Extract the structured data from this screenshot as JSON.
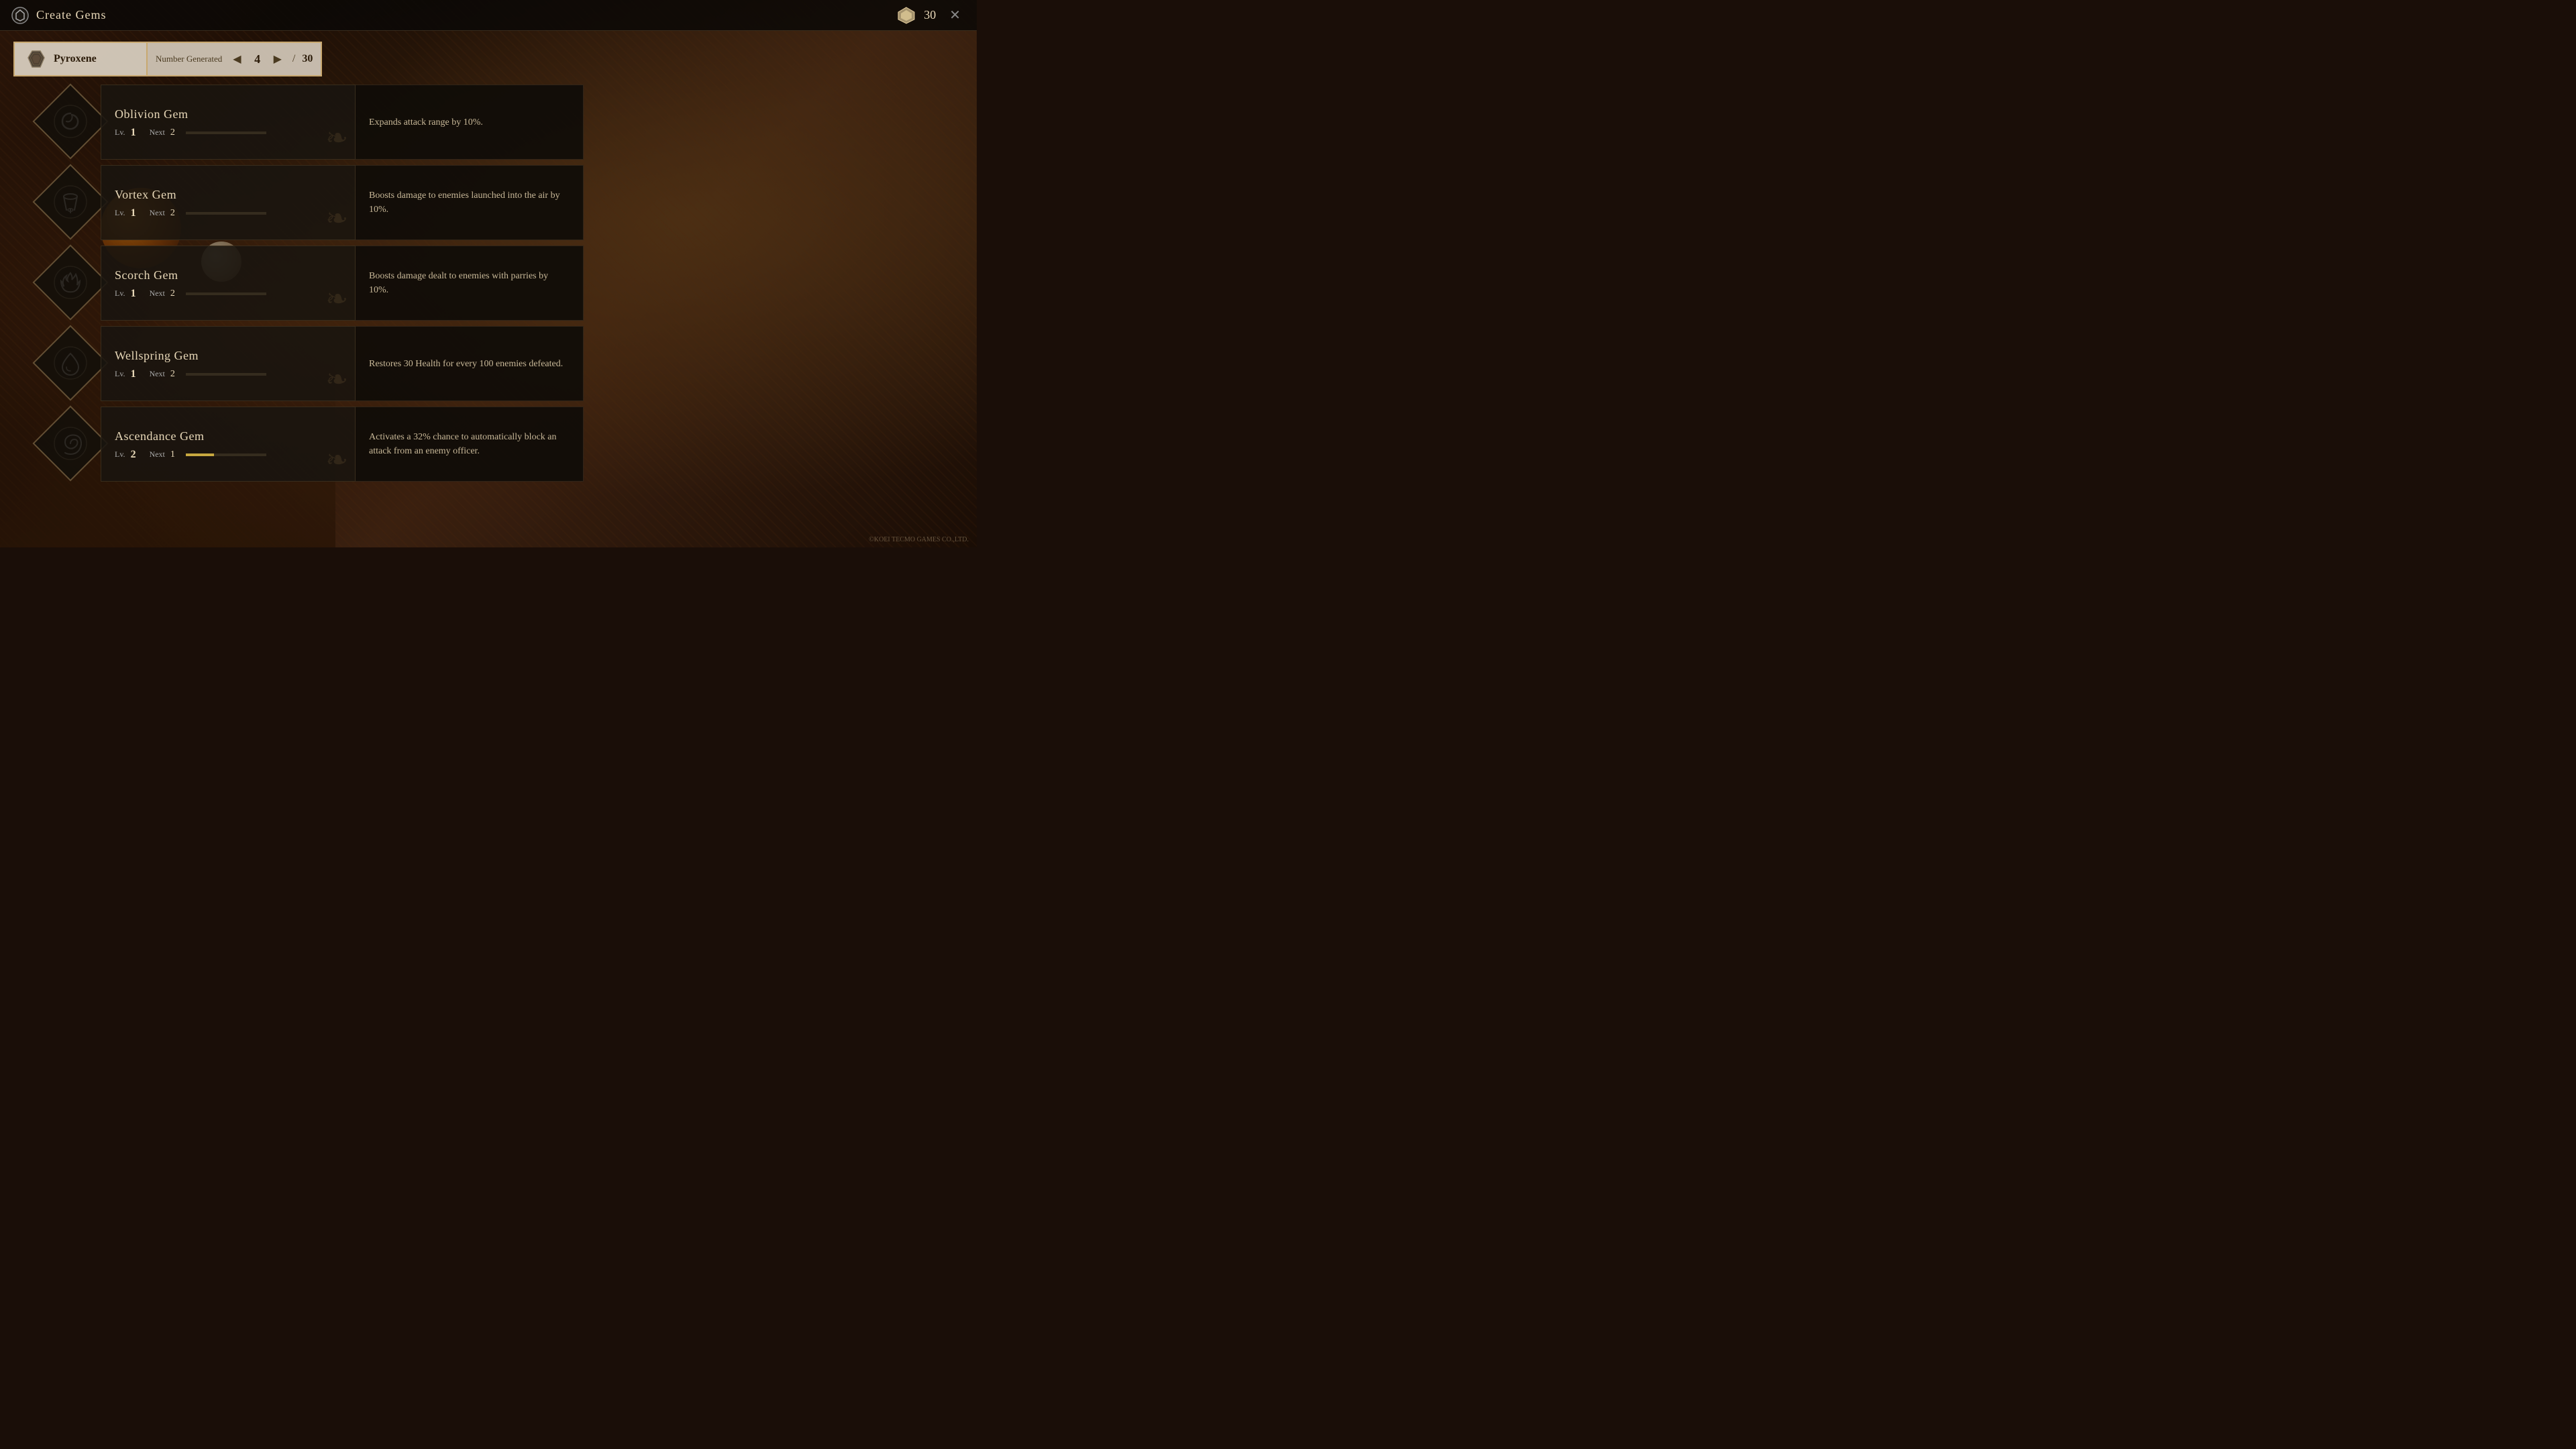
{
  "window": {
    "title": "Create Gems",
    "close_label": "✕"
  },
  "currency": {
    "icon_label": "currency-icon",
    "count": "30"
  },
  "material": {
    "name": "Pyroxene",
    "icon_label": "pyroxene-icon"
  },
  "number_control": {
    "label": "Number Generated",
    "value": "4",
    "total": "30",
    "prev_label": "◀",
    "next_label": "▶",
    "divider": "/"
  },
  "gems": [
    {
      "id": "oblivion",
      "name": "Oblivion Gem",
      "level": "1",
      "next_label": "Next",
      "next_value": "2",
      "progress": 0,
      "description": "Expands attack range by 10%.",
      "icon_type": "swirl"
    },
    {
      "id": "vortex",
      "name": "Vortex Gem",
      "level": "1",
      "next_label": "Next",
      "next_value": "2",
      "progress": 0,
      "description": "Boosts damage to enemies launched into the air by 10%.",
      "icon_type": "tornado"
    },
    {
      "id": "scorch",
      "name": "Scorch Gem",
      "level": "1",
      "next_label": "Next",
      "next_value": "2",
      "progress": 0,
      "description": "Boosts damage dealt to enemies with parries by 10%.",
      "icon_type": "flame"
    },
    {
      "id": "wellspring",
      "name": "Wellspring Gem",
      "level": "1",
      "next_label": "Next",
      "next_value": "2",
      "progress": 0,
      "description": "Restores 30 Health for every 100 enemies defeated.",
      "icon_type": "droplet"
    },
    {
      "id": "ascendance",
      "name": "Ascendance Gem",
      "level": "2",
      "next_label": "Next",
      "next_value": "1",
      "progress": 35,
      "description": "Activates a 32% chance to automatically block an attack from an enemy officer.",
      "icon_type": "spiral"
    }
  ],
  "copyright": "©KOEI TECMO GAMES CO.,LTD.",
  "lv_label": "Lv."
}
